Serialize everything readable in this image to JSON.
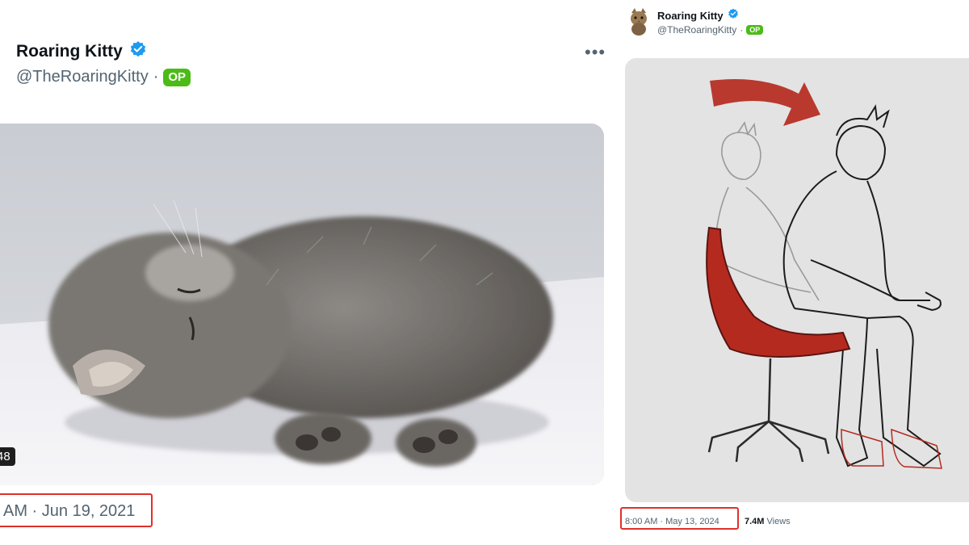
{
  "left_tweet": {
    "display_name": "Roaring Kitty",
    "handle": "@TheRoaringKitty",
    "separator": "·",
    "badge": "OP",
    "more_label": "•••",
    "video_duration": "48",
    "timestamp": "AM · Jun 19, 2021",
    "media_icon": "sleeping-kitten-photo"
  },
  "right_tweet": {
    "display_name": "Roaring Kitty",
    "handle": "@TheRoaringKitty",
    "separator": "·",
    "badge": "OP",
    "timestamp": "8:00 AM · May 13, 2024",
    "views_count": "7.4M",
    "views_label": "Views",
    "media_icon": "gamer-leaning-forward-sketch"
  },
  "colors": {
    "verified_blue": "#1d9bf0",
    "op_green": "#4cbb17",
    "highlight_red": "#e0302a",
    "chair_red": "#b52a1f"
  }
}
